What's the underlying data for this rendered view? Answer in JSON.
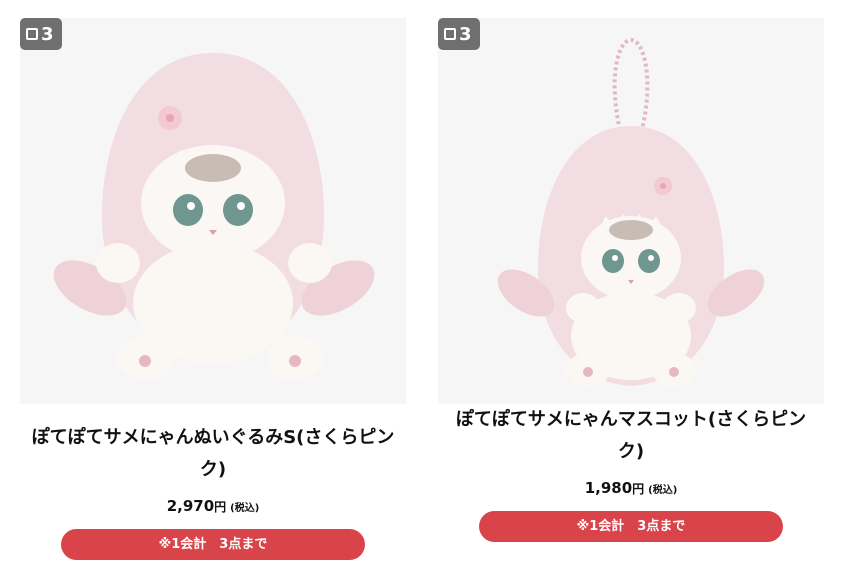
{
  "products": [
    {
      "badge_count": "3",
      "image_icon": "plush-shark-cat-s-image",
      "title": "ぽてぽてサメにゃんぬいぐるみS(さくらピンク)",
      "price": "2,970",
      "yen": "円",
      "tax": "(税込)",
      "limit": "※1会計　3点まで"
    },
    {
      "badge_count": "3",
      "image_icon": "plush-shark-cat-mascot-image",
      "title": "ぽてぽてサメにゃんマスコット(さくらピンク)",
      "price": "1,980",
      "yen": "円",
      "tax": "(税込)",
      "limit": "※1会計　3点まで"
    }
  ],
  "colors": {
    "badge": "#6f6f6f",
    "limit_button": "#d9434a",
    "image_bg": "#f7f6f7"
  }
}
